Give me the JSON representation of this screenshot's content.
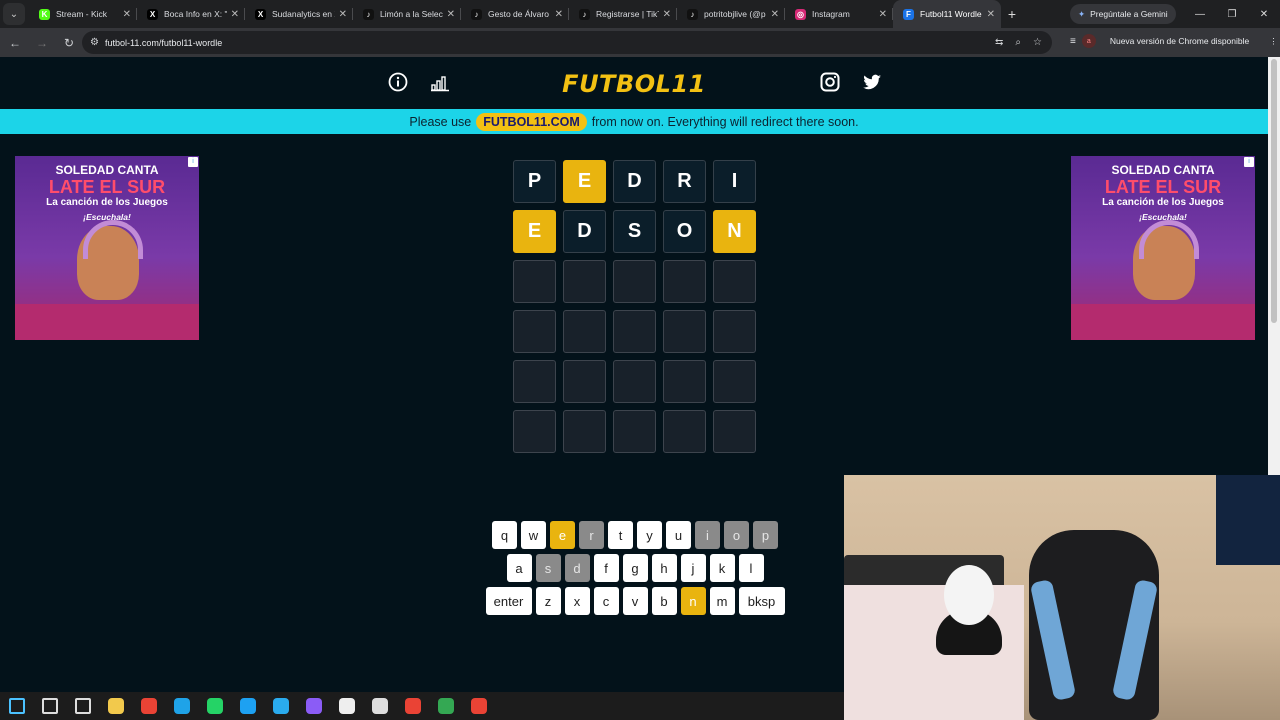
{
  "browser": {
    "tabs": [
      {
        "title": "Stream - Kick",
        "color": "#53fc18",
        "glyph": "K"
      },
      {
        "title": "Boca Info en X: \"V",
        "color": "#000000",
        "glyph": "X"
      },
      {
        "title": "Sudanalytics en X:",
        "color": "#000000",
        "glyph": "X"
      },
      {
        "title": "Limón a la Selecc",
        "color": "#111111",
        "glyph": "♪"
      },
      {
        "title": "Gesto de Álvaro M",
        "color": "#111111",
        "glyph": "♪"
      },
      {
        "title": "Registrarse | TikTo",
        "color": "#111111",
        "glyph": "♪"
      },
      {
        "title": "potritobjlive (@p",
        "color": "#111111",
        "glyph": "♪"
      },
      {
        "title": "Instagram",
        "color": "#d62976",
        "glyph": "◎"
      },
      {
        "title": "Futbol11 Wordle",
        "color": "#1a73e8",
        "glyph": "F"
      }
    ],
    "gemini_label": "Pregúntale a Gemini",
    "url": "futbol-11.com/futbol11-wordle",
    "chrome_update": "Nueva versión de Chrome disponible",
    "profile_initial": "a"
  },
  "site": {
    "logo": "FUTBOL11",
    "banner_before": "Please use",
    "banner_pill": "FUTBOL11.COM",
    "banner_after": "from now on. Everything will redirect there soon."
  },
  "ad": {
    "line1": "SOLEDAD CANTA",
    "line2": "LATE EL SUR",
    "line3": "La canción de los Juegos",
    "line4": "¡Escuchala!"
  },
  "grid": {
    "rows": [
      [
        {
          "l": "P",
          "s": "absent"
        },
        {
          "l": "E",
          "s": "present"
        },
        {
          "l": "D",
          "s": "absent"
        },
        {
          "l": "R",
          "s": "absent"
        },
        {
          "l": "I",
          "s": "absent"
        }
      ],
      [
        {
          "l": "E",
          "s": "present"
        },
        {
          "l": "D",
          "s": "absent"
        },
        {
          "l": "S",
          "s": "absent"
        },
        {
          "l": "O",
          "s": "absent"
        },
        {
          "l": "N",
          "s": "present"
        }
      ],
      [
        {
          "l": "",
          "s": "empty"
        },
        {
          "l": "",
          "s": "empty"
        },
        {
          "l": "",
          "s": "empty"
        },
        {
          "l": "",
          "s": "empty"
        },
        {
          "l": "",
          "s": "empty"
        }
      ],
      [
        {
          "l": "",
          "s": "empty"
        },
        {
          "l": "",
          "s": "empty"
        },
        {
          "l": "",
          "s": "empty"
        },
        {
          "l": "",
          "s": "empty"
        },
        {
          "l": "",
          "s": "empty"
        }
      ],
      [
        {
          "l": "",
          "s": "empty"
        },
        {
          "l": "",
          "s": "empty"
        },
        {
          "l": "",
          "s": "empty"
        },
        {
          "l": "",
          "s": "empty"
        },
        {
          "l": "",
          "s": "empty"
        }
      ],
      [
        {
          "l": "",
          "s": "empty"
        },
        {
          "l": "",
          "s": "empty"
        },
        {
          "l": "",
          "s": "empty"
        },
        {
          "l": "",
          "s": "empty"
        },
        {
          "l": "",
          "s": "empty"
        }
      ]
    ]
  },
  "keyboard": {
    "rows": [
      [
        {
          "k": "q",
          "s": ""
        },
        {
          "k": "w",
          "s": ""
        },
        {
          "k": "e",
          "s": "present"
        },
        {
          "k": "r",
          "s": "absent"
        },
        {
          "k": "t",
          "s": ""
        },
        {
          "k": "y",
          "s": ""
        },
        {
          "k": "u",
          "s": ""
        },
        {
          "k": "i",
          "s": "absent"
        },
        {
          "k": "o",
          "s": "absent"
        },
        {
          "k": "p",
          "s": "absent"
        }
      ],
      [
        {
          "k": "a",
          "s": ""
        },
        {
          "k": "s",
          "s": "absent"
        },
        {
          "k": "d",
          "s": "absent"
        },
        {
          "k": "f",
          "s": ""
        },
        {
          "k": "g",
          "s": ""
        },
        {
          "k": "h",
          "s": ""
        },
        {
          "k": "j",
          "s": ""
        },
        {
          "k": "k",
          "s": ""
        },
        {
          "k": "l",
          "s": ""
        }
      ],
      [
        {
          "k": "enter",
          "s": "",
          "wide": true
        },
        {
          "k": "z",
          "s": ""
        },
        {
          "k": "x",
          "s": ""
        },
        {
          "k": "c",
          "s": ""
        },
        {
          "k": "v",
          "s": ""
        },
        {
          "k": "b",
          "s": ""
        },
        {
          "k": "n",
          "s": "present"
        },
        {
          "k": "m",
          "s": ""
        },
        {
          "k": "bksp",
          "s": "",
          "wide": true
        }
      ]
    ]
  },
  "colors": {
    "accent": "#f3c113",
    "present": "#e9b40f",
    "banner": "#1cd4e8",
    "background": "#03121a"
  },
  "taskbar": {
    "icons": [
      "windows-start-icon",
      "search-icon",
      "task-view-icon",
      "file-explorer-icon",
      "chrome-icon",
      "edge-icon",
      "whatsapp-icon",
      "twitter-icon",
      "telegram-icon",
      "messenger-icon",
      "capcut-icon",
      "obs-icon",
      "chrome-profile-icon",
      "chrome-profile-icon",
      "chrome-profile-icon"
    ]
  }
}
